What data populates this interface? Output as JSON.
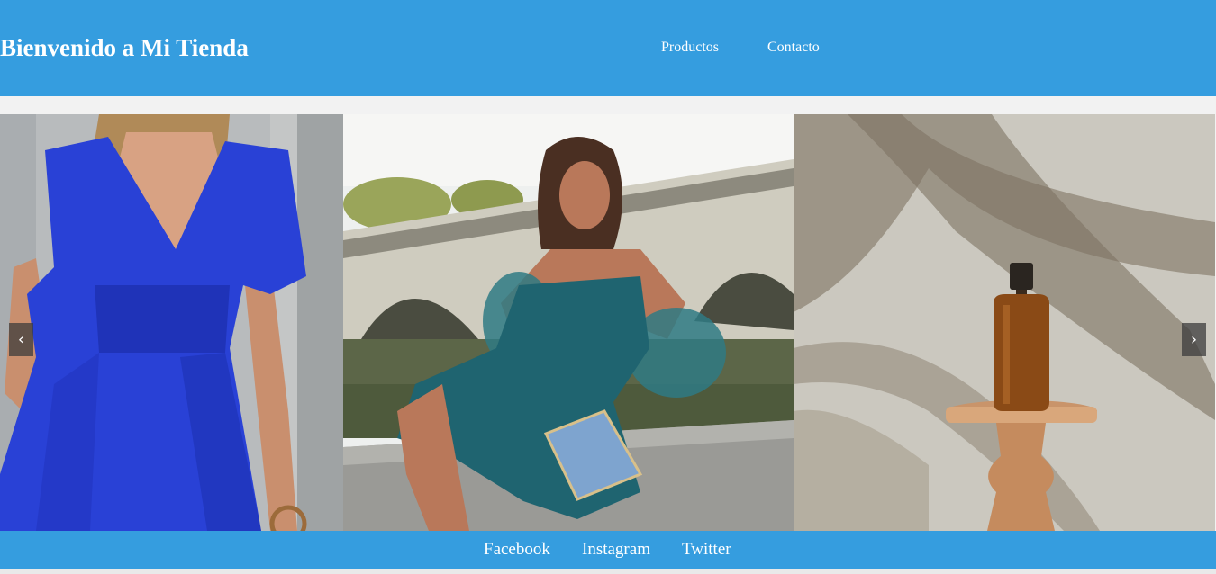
{
  "header": {
    "title": "Bienvenido a Mi Tienda",
    "nav": [
      {
        "label": "Productos"
      },
      {
        "label": "Contacto"
      }
    ]
  },
  "carousel": {
    "prev_icon": "chevron-left-icon",
    "prev_glyph": "‹",
    "next_icon": "chevron-right-icon",
    "next_glyph": "›",
    "slides": [
      {
        "subject": "woman-in-blue-dress"
      },
      {
        "subject": "woman-in-teal-dress-by-bridge"
      },
      {
        "subject": "amber-dropper-bottle-on-wooden-stand"
      }
    ]
  },
  "footer": {
    "links": [
      {
        "label": "Facebook"
      },
      {
        "label": "Instagram"
      },
      {
        "label": "Twitter"
      }
    ]
  },
  "colors": {
    "brand": "#359ddf",
    "page_bg": "#f2f2f2",
    "text_on_brand": "#ffffff"
  }
}
